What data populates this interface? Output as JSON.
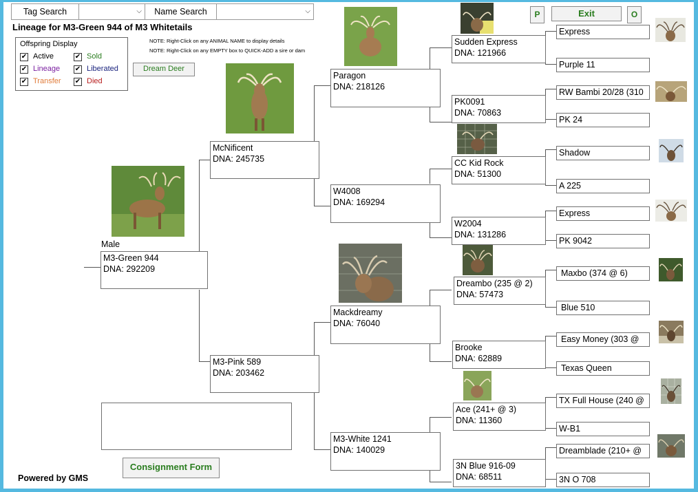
{
  "search": {
    "tag_label": "Tag Search",
    "tag_value": "",
    "name_label": "Name Search",
    "name_value": ""
  },
  "buttons": {
    "p": "P",
    "exit": "Exit",
    "o": "O",
    "dream_deer": "Dream Deer",
    "consignment": "Consignment Form"
  },
  "page_title": "Lineage for M3-Green 944 of M3 Whitetails",
  "offspring_display": {
    "heading": "Offspring Display",
    "items": [
      {
        "label": "Active",
        "checked": true,
        "color": "#000000"
      },
      {
        "label": "Lineage",
        "checked": true,
        "color": "#7a1fa0"
      },
      {
        "label": "Transfer",
        "checked": true,
        "color": "#e07b39"
      },
      {
        "label": "Sold",
        "checked": true,
        "color": "#2a7d1f"
      },
      {
        "label": "Liberated",
        "checked": true,
        "color": "#1a237e"
      },
      {
        "label": "Died",
        "checked": true,
        "color": "#b71c1c"
      }
    ]
  },
  "notes": [
    "NOTE: Right-Click on any ANIMAL NAME to display details",
    "NOTE: Right-Click on any EMPTY box to QUICK-ADD a sire or dam"
  ],
  "subject": {
    "sex": "Male",
    "name": "M3-Green 944",
    "dna": "DNA: 292209"
  },
  "sire": {
    "name": "McNificent",
    "dna": "DNA: 245735"
  },
  "dam": {
    "name": "M3-Pink 589",
    "dna": "DNA: 203462"
  },
  "gen3": [
    {
      "name": "Paragon",
      "dna": "DNA: 218126"
    },
    {
      "name": "W4008",
      "dna": "DNA: 169294"
    },
    {
      "name": "Mackdreamy",
      "dna": "DNA: 76040"
    },
    {
      "name": "M3-White 1241",
      "dna": "DNA: 140029"
    }
  ],
  "gen4": [
    {
      "name": "Sudden Express",
      "dna": "DNA: 121966"
    },
    {
      "name": "PK0091",
      "dna": "DNA: 70863"
    },
    {
      "name": "CC Kid Rock",
      "dna": "DNA: 51300"
    },
    {
      "name": "W2004",
      "dna": "DNA: 131286"
    },
    {
      "name": "Dreambo (235 @ 2)",
      "dna": "DNA: 57473"
    },
    {
      "name": "Brooke",
      "dna": "DNA: 62889"
    },
    {
      "name": "Ace (241+ @ 3)",
      "dna": "DNA: 11360"
    },
    {
      "name": "3N Blue 916-09",
      "dna": "DNA: 68511"
    }
  ],
  "gen5": [
    "Express",
    "Purple 11",
    "RW Bambi 20/28 (310",
    "PK 24",
    "Shadow",
    "A 225",
    "Express",
    "PK 9042",
    "Maxbo (374 @ 6)",
    "Blue 510",
    "Easy Money (303 @",
    "Texas Queen",
    "TX Full House (240 @",
    "W-B1",
    "Dreamblade (210+ @",
    "3N O 708"
  ],
  "footer": "Powered by GMS"
}
